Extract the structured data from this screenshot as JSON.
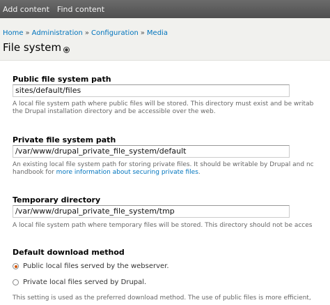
{
  "toolbar": {
    "items": [
      "Add content",
      "Find content"
    ]
  },
  "breadcrumb": {
    "items": [
      "Home",
      "Administration",
      "Configuration",
      "Media"
    ],
    "separator": "»"
  },
  "page": {
    "title": "File system"
  },
  "public_path": {
    "label": "Public file system path",
    "value": "sites/default/files",
    "description_line1": "A local file system path where public files will be stored. This directory must exist and be writab",
    "description_line2": "the Drupal installation directory and be accessible over the web."
  },
  "private_path": {
    "label": "Private file system path",
    "value": "/var/www/drupal_private_file_system/default",
    "description_line1": "An existing local file system path for storing private files. It should be writable by Drupal and nc",
    "description_line2_prefix": "handbook for ",
    "description_link": "more information about securing private files",
    "description_line2_suffix": "."
  },
  "temp_dir": {
    "label": "Temporary directory",
    "value": "/var/www/drupal_private_file_system/tmp",
    "description": "A local file system path where temporary files will be stored. This directory should not be acces"
  },
  "download_method": {
    "label": "Default download method",
    "options": [
      {
        "label": "Public local files served by the webserver.",
        "checked": true
      },
      {
        "label": "Private local files served by Drupal.",
        "checked": false
      }
    ],
    "description": "This setting is used as the preferred download method. The use of public files is more efficient,"
  },
  "colors": {
    "toolbar": "#5c5c5c",
    "link": "#0074bd",
    "radio_checked": "#d35400"
  }
}
